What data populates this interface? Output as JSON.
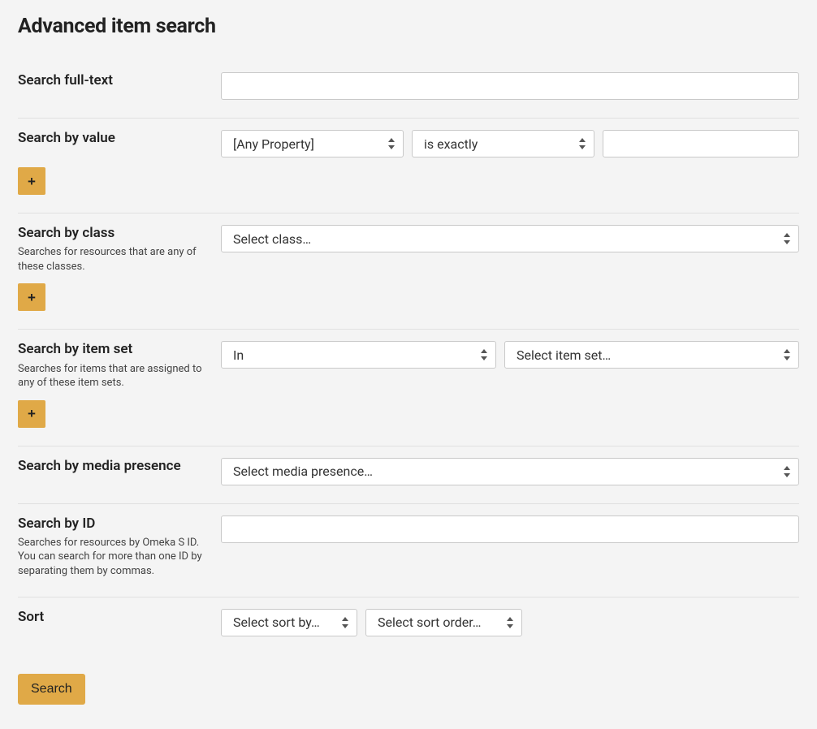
{
  "title": "Advanced item search",
  "fields": {
    "fulltext": {
      "label": "Search full-text",
      "value": ""
    },
    "value": {
      "label": "Search by value",
      "property_select": "[Any Property]",
      "operator_select": "is exactly",
      "text_value": "",
      "add_aria": "Add new value"
    },
    "class": {
      "label": "Search by class",
      "desc": "Searches for resources that are any of these classes.",
      "select": "Select class…",
      "add_aria": "Add new class"
    },
    "itemset": {
      "label": "Search by item set",
      "desc": "Searches for items that are assigned to any of these item sets.",
      "in_select": "In",
      "set_select": "Select item set…",
      "add_aria": "Add new item set"
    },
    "media": {
      "label": "Search by media presence",
      "select": "Select media presence…"
    },
    "id": {
      "label": "Search by ID",
      "desc": "Searches for resources by Omeka S ID. You can search for more than one ID by separating them by commas.",
      "value": ""
    },
    "sort": {
      "label": "Sort",
      "by_select": "Select sort by…",
      "order_select": "Select sort order…"
    }
  },
  "buttons": {
    "add": "+",
    "search": "Search"
  }
}
